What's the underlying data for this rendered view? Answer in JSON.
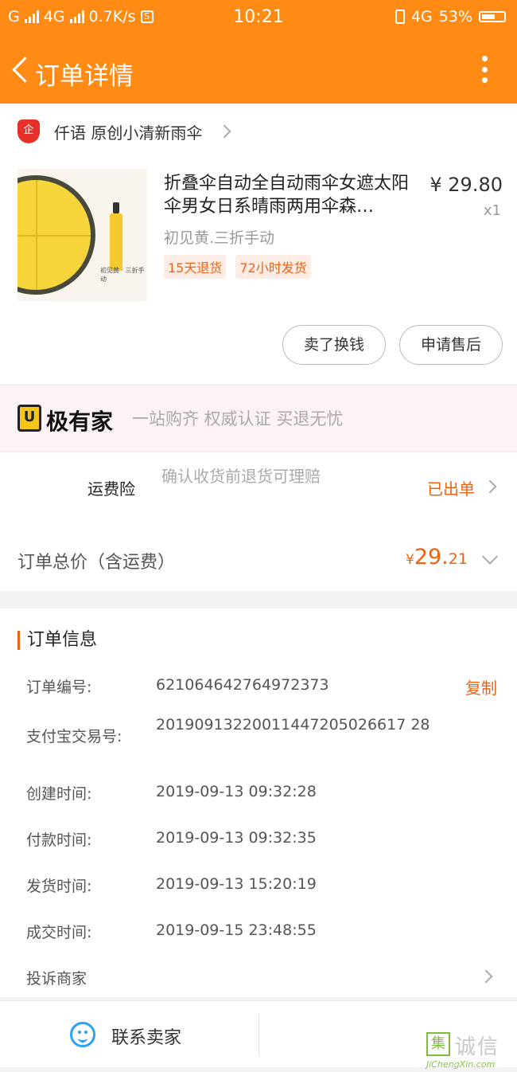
{
  "status_bar": {
    "carrier1": "G",
    "carrier2": "4G",
    "speed": "0.7K/s",
    "sim_badge": "S",
    "time": "10:21",
    "network": "4G",
    "battery": "53%"
  },
  "nav": {
    "title": "订单详情"
  },
  "shop": {
    "badge": "企",
    "name": "仟语 原创小清新雨伞"
  },
  "product": {
    "title": "折叠伞自动全自动雨伞女遮太阳伞男女日系晴雨两用伞森…",
    "price": "¥ 29.80",
    "qty": "x1",
    "variant": "初见黄.三折手动",
    "tags": [
      "15天退货",
      "72小时发货"
    ],
    "thumb_caption": "初见黄 · 三折手动"
  },
  "actions": {
    "sell": "卖了换钱",
    "after_sale": "申请售后"
  },
  "ad": {
    "logo_glyph": "U",
    "brand": "极有家",
    "slogan": "一站购齐 权威认证 买退无忧"
  },
  "freight": {
    "label": "运费险",
    "desc": "确认收货前退货可理赔",
    "status": "已出单"
  },
  "total": {
    "label": "订单总价（含运费）",
    "currency": "¥",
    "integer": "29.",
    "decimal": "21"
  },
  "order_info": {
    "heading": "订单信息",
    "copy": "复制",
    "rows": [
      {
        "label": "订单编号:",
        "value": "621064642764972373"
      },
      {
        "label": "支付宝交易号:",
        "value": "20190913220011447205026617 28"
      },
      {
        "label": "创建时间:",
        "value": "2019-09-13 09:32:28"
      },
      {
        "label": "付款时间:",
        "value": "2019-09-13 09:32:35"
      },
      {
        "label": "发货时间:",
        "value": "2019-09-13 15:20:19"
      },
      {
        "label": "成交时间:",
        "value": "2019-09-15 23:48:55"
      }
    ],
    "complaint": "投诉商家"
  },
  "bottom": {
    "contact": "联系卖家"
  },
  "watermark": {
    "box": "集",
    "cn": "诚信",
    "en": "JiChengXin.com"
  },
  "colors": {
    "header": "#ff8a14",
    "accent": "#f0620f"
  }
}
